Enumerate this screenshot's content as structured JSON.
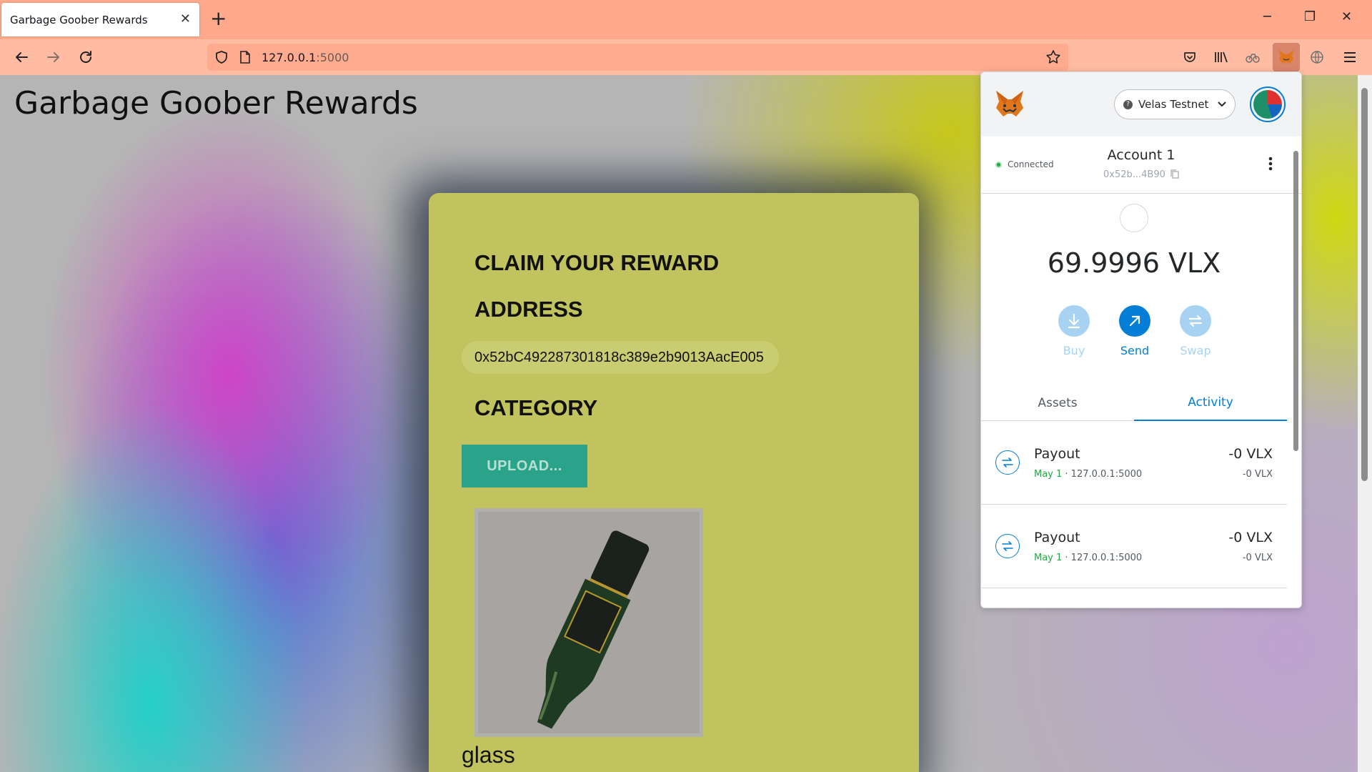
{
  "browser": {
    "tab_title": "Garbage Goober Rewards",
    "tab_close": "✕",
    "new_tab": "+",
    "url_host": "127.0.0.1",
    "url_port": ":5000",
    "window": {
      "minimize": "─",
      "restore": "❐",
      "close": "✕"
    }
  },
  "page": {
    "title": "Garbage Goober Rewards",
    "claim_heading": "CLAIM YOUR REWARD",
    "address_heading": "ADDRESS",
    "address_value": "0x52bC492287301818c389e2b9013AacE005",
    "category_heading": "CATEGORY",
    "upload_label": "UPLOAD...",
    "category_result": "glass"
  },
  "metamask": {
    "network": "Velas Testnet",
    "network_icon": "?",
    "connected_label": "Connected",
    "account_name": "Account 1",
    "account_address": "0x52b...4B90",
    "balance": "69.9996 VLX",
    "actions": [
      {
        "label": "Buy",
        "icon": "download-icon",
        "color": "#a8d2f2",
        "label_color": "#a8d2f2"
      },
      {
        "label": "Send",
        "icon": "arrow-up-right-icon",
        "color": "#037dd6",
        "label_color": "#037dd6"
      },
      {
        "label": "Swap",
        "icon": "swap-icon",
        "color": "#a8d2f2",
        "label_color": "#a8d2f2"
      }
    ],
    "tabs": {
      "assets": "Assets",
      "activity": "Activity"
    },
    "transactions": [
      {
        "title": "Payout",
        "date": "May 1",
        "origin": " · 127.0.0.1:5000",
        "amount": "-0 VLX",
        "amount_secondary": "-0 VLX"
      },
      {
        "title": "Payout",
        "date": "May 1",
        "origin": " · 127.0.0.1:5000",
        "amount": "-0 VLX",
        "amount_secondary": "-0 VLX"
      }
    ]
  },
  "colors": {
    "chrome_tabbar": "#ffa98c",
    "chrome_toolbar": "#ffbca2",
    "card": "#c1c45e",
    "upload_button": "#2aa38a",
    "metamask_blue": "#037dd6",
    "success_green": "#28a745"
  }
}
